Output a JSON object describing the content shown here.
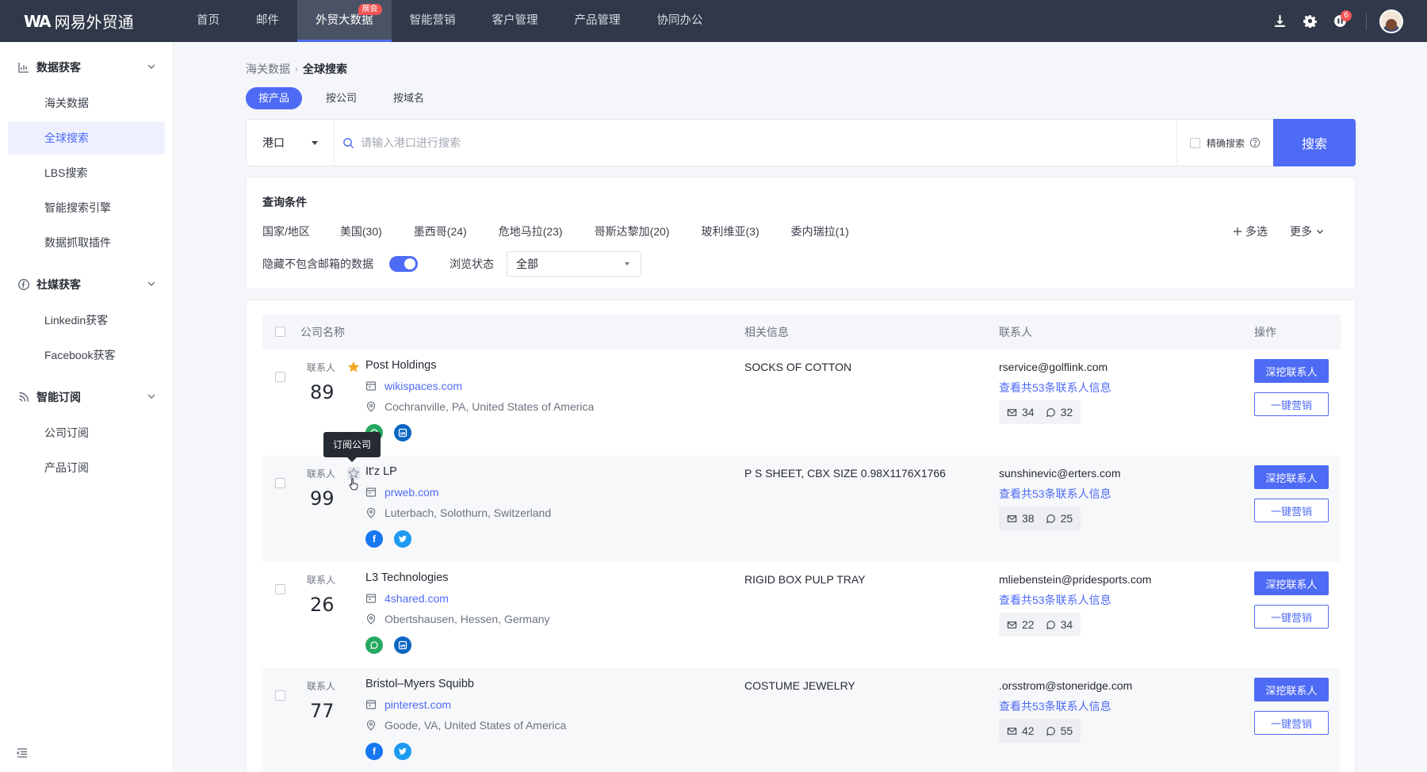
{
  "app": {
    "logo_mark": "WA",
    "logo_text": "网易外贸通"
  },
  "nav": {
    "items": [
      {
        "label": "首页"
      },
      {
        "label": "邮件"
      },
      {
        "label": "外贸大数据",
        "badge": "展会",
        "active": true
      },
      {
        "label": "智能营销"
      },
      {
        "label": "客户管理"
      },
      {
        "label": "产品管理"
      },
      {
        "label": "协同办公"
      }
    ],
    "notify_count": "6"
  },
  "sidebar": {
    "groups": [
      {
        "title": "数据获客",
        "icon": "bar-chart-icon",
        "items": [
          "海关数据",
          "全球搜索",
          "LBS搜索",
          "智能搜索引擎",
          "数据抓取插件"
        ]
      },
      {
        "title": "社媒获客",
        "icon": "social-icon",
        "items": [
          "Linkedin获客",
          "Facebook获客"
        ]
      },
      {
        "title": "智能订阅",
        "icon": "rss-icon",
        "items": [
          "公司订阅",
          "产品订阅"
        ]
      }
    ],
    "active_item": "全球搜索"
  },
  "breadcrumb": {
    "parent": "海关数据",
    "current": "全球搜索"
  },
  "search_tabs": [
    "按产品",
    "按公司",
    "按域名"
  ],
  "search": {
    "scope": "港口",
    "placeholder": "请输入港口进行搜索",
    "exact_label": "精确搜索",
    "button": "搜索"
  },
  "filters": {
    "title": "查询条件",
    "country_label": "国家/地区",
    "countries": [
      "美国(30)",
      "墨西哥(24)",
      "危地马拉(23)",
      "哥斯达黎加(20)",
      "玻利维亚(3)",
      "委内瑞拉(1)"
    ],
    "multi_label": "多选",
    "more_label": "更多",
    "hide_no_email_label": "隐藏不包含邮箱的数据",
    "hide_no_email_on": true,
    "browse_status_label": "浏览状态",
    "browse_status_value": "全部"
  },
  "table": {
    "headers": {
      "company": "公司名称",
      "info": "相关信息",
      "contact": "联系人",
      "action": "操作"
    },
    "contact_label": "联系人",
    "view_all_label": "查看共53条联系人信息",
    "dig_label": "深挖联系人",
    "marketing_label": "一键营销",
    "rows": [
      {
        "count": "89",
        "starred": true,
        "company": "Post Holdings",
        "site": "wikispaces.com",
        "address": "Cochranville, PA, United States of America",
        "socials": [
          "whatsapp",
          "linkedin"
        ],
        "product": "SOCKS OF COTTON",
        "email": "rservice@golflink.com",
        "mail_count": "34",
        "wa_count": "32"
      },
      {
        "count": "99",
        "starred": false,
        "company": "It'z LP",
        "site": "prweb.com",
        "address": "Luterbach, Solothurn, Switzerland",
        "socials": [
          "facebook",
          "twitter"
        ],
        "product": "P S SHEET, CBX SIZE 0.98X1176X1766",
        "email": "sunshinevic@erters.com",
        "mail_count": "38",
        "wa_count": "25"
      },
      {
        "count": "26",
        "starred": false,
        "company": "L3 Technologies",
        "site": "4shared.com",
        "address": "Obertshausen, Hessen, Germany",
        "socials": [
          "whatsapp",
          "linkedin"
        ],
        "product": "RIGID BOX PULP TRAY",
        "email": "mliebenstein@pridesports.com",
        "mail_count": "22",
        "wa_count": "34"
      },
      {
        "count": "77",
        "starred": false,
        "company": "Bristol–Myers Squibb",
        "site": "pinterest.com",
        "address": "Goode, VA, United States of America",
        "socials": [
          "facebook",
          "twitter"
        ],
        "product": "COSTUME JEWELRY",
        "email": ".orsstrom@stoneridge.com",
        "mail_count": "42",
        "wa_count": "55"
      }
    ]
  },
  "tooltip": "订阅公司",
  "colors": {
    "primary": "#4e6bf5",
    "topbar": "#303849",
    "badge": "#f25555",
    "star": "#f5a623"
  }
}
